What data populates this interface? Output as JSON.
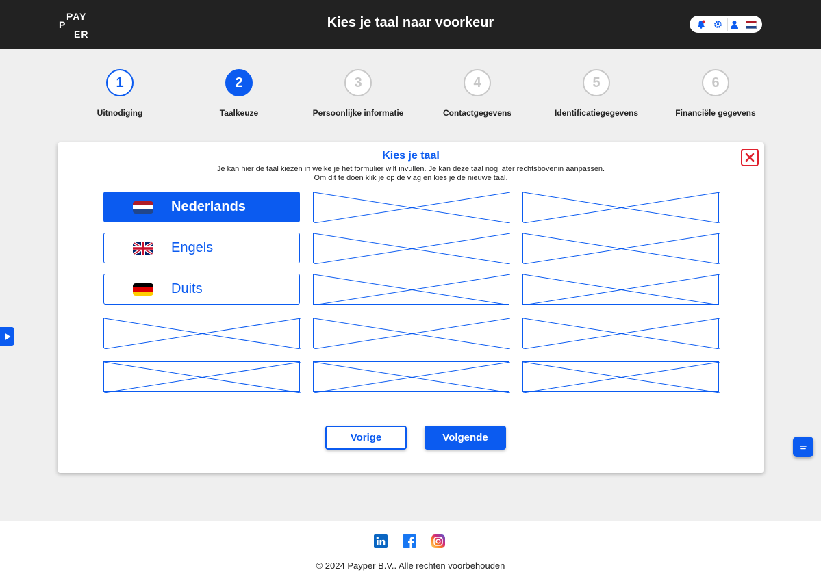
{
  "header": {
    "logo": {
      "pay": "PAY",
      "p": "P",
      "er": "ER"
    },
    "title": "Kies je taal naar voorkeur",
    "tools": [
      "bell-icon",
      "gear-icon",
      "user-icon",
      "flag-nl-icon"
    ]
  },
  "stepper": {
    "current": 2,
    "steps": [
      {
        "number": "1",
        "label": "Uitnodiging",
        "state": "done"
      },
      {
        "number": "2",
        "label": "Taalkeuze",
        "state": "active"
      },
      {
        "number": "3",
        "label": "Persoonlijke informatie",
        "state": "upcoming"
      },
      {
        "number": "4",
        "label": "Contactgegevens",
        "state": "upcoming"
      },
      {
        "number": "5",
        "label": "Identificatiegegevens",
        "state": "upcoming"
      },
      {
        "number": "6",
        "label": "Financiële gegevens",
        "state": "upcoming"
      }
    ]
  },
  "card": {
    "title": "Kies je taal",
    "description_line1": "Je kan hier de taal kiezen in welke je het formulier wilt invullen. Je kan deze taal nog later rechtsbovenin aanpassen.",
    "description_line2": "Om dit te doen klik je op de vlag en kies je de nieuwe taal.",
    "languages": [
      {
        "name": "Nederlands",
        "flag": "nl",
        "selected": true
      },
      {
        "name": "Engels",
        "flag": "gb",
        "selected": false
      },
      {
        "name": "Duits",
        "flag": "de",
        "selected": false
      }
    ],
    "prev_label": "Vorige",
    "next_label": "Volgende"
  },
  "footer": {
    "socials": [
      "linkedin-icon",
      "facebook-icon",
      "instagram-icon"
    ],
    "copyright": "© 2024 Payper B.V.. Alle rechten voorbehouden"
  },
  "colors": {
    "accent": "#0b5bf0",
    "header_bg": "#222222",
    "close_red": "#e0212e"
  }
}
